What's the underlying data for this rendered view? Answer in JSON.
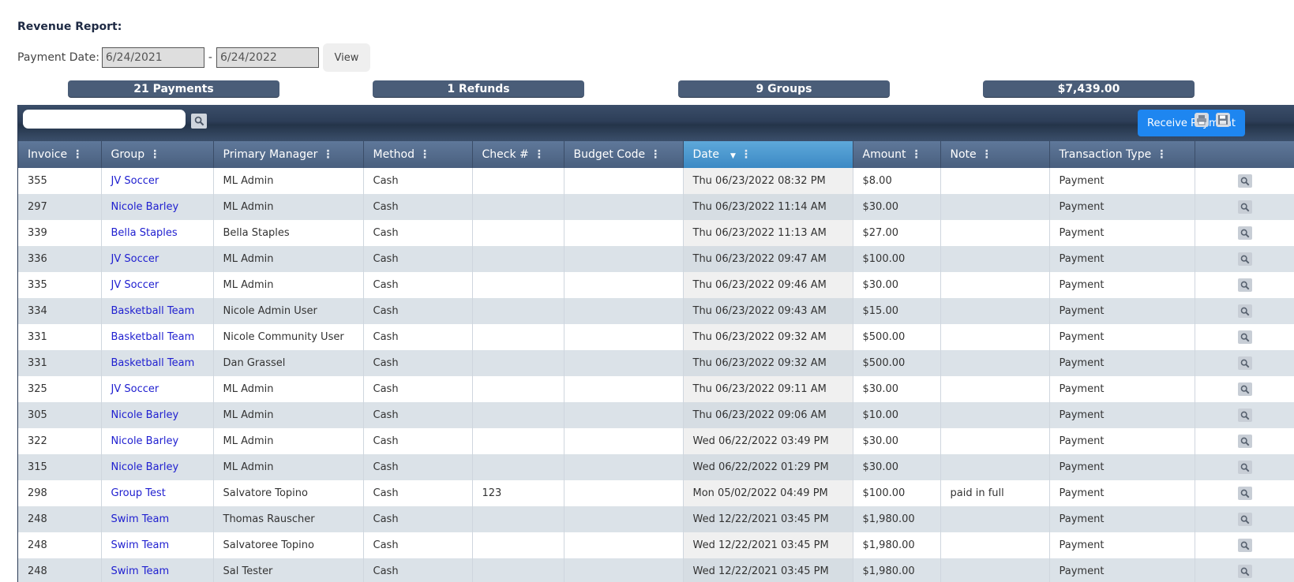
{
  "report": {
    "title": "Revenue Report:",
    "date_label": "Payment Date:",
    "start_date": "6/24/2021",
    "date_separator": "-",
    "end_date": "6/24/2022",
    "view_label": "View"
  },
  "stats": {
    "payments": "21 Payments",
    "refunds": "1 Refunds",
    "groups": "9 Groups",
    "total": "$7,439.00"
  },
  "toolbar": {
    "search_value": "",
    "receive_label": "Receive Payment"
  },
  "table": {
    "columns": [
      "Invoice",
      "Group",
      "Primary Manager",
      "Method",
      "Check #",
      "Budget Code",
      "Date",
      "Amount",
      "Note",
      "Transaction Type"
    ],
    "sorted_column": "Date",
    "rows": [
      [
        "355",
        "JV Soccer",
        "ML Admin",
        "Cash",
        "",
        "",
        "Thu 06/23/2022 08:32 PM",
        "$8.00",
        "",
        "Payment"
      ],
      [
        "297",
        "Nicole Barley",
        "ML Admin",
        "Cash",
        "",
        "",
        "Thu 06/23/2022 11:14 AM",
        "$30.00",
        "",
        "Payment"
      ],
      [
        "339",
        "Bella Staples",
        "Bella Staples",
        "Cash",
        "",
        "",
        "Thu 06/23/2022 11:13 AM",
        "$27.00",
        "",
        "Payment"
      ],
      [
        "336",
        "JV Soccer",
        "ML Admin",
        "Cash",
        "",
        "",
        "Thu 06/23/2022 09:47 AM",
        "$100.00",
        "",
        "Payment"
      ],
      [
        "335",
        "JV Soccer",
        "ML Admin",
        "Cash",
        "",
        "",
        "Thu 06/23/2022 09:46 AM",
        "$30.00",
        "",
        "Payment"
      ],
      [
        "334",
        "Basketball Team",
        "Nicole Admin User",
        "Cash",
        "",
        "",
        "Thu 06/23/2022 09:43 AM",
        "$15.00",
        "",
        "Payment"
      ],
      [
        "331",
        "Basketball Team",
        "Nicole Community User",
        "Cash",
        "",
        "",
        "Thu 06/23/2022 09:32 AM",
        "$500.00",
        "",
        "Payment"
      ],
      [
        "331",
        "Basketball Team",
        "Dan Grassel",
        "Cash",
        "",
        "",
        "Thu 06/23/2022 09:32 AM",
        "$500.00",
        "",
        "Payment"
      ],
      [
        "325",
        "JV Soccer",
        "ML Admin",
        "Cash",
        "",
        "",
        "Thu 06/23/2022 09:11 AM",
        "$30.00",
        "",
        "Payment"
      ],
      [
        "305",
        "Nicole Barley",
        "ML Admin",
        "Cash",
        "",
        "",
        "Thu 06/23/2022 09:06 AM",
        "$10.00",
        "",
        "Payment"
      ],
      [
        "322",
        "Nicole Barley",
        "ML Admin",
        "Cash",
        "",
        "",
        "Wed 06/22/2022 03:49 PM",
        "$30.00",
        "",
        "Payment"
      ],
      [
        "315",
        "Nicole Barley",
        "ML Admin",
        "Cash",
        "",
        "",
        "Wed 06/22/2022 01:29 PM",
        "$30.00",
        "",
        "Payment"
      ],
      [
        "298",
        "Group Test",
        "Salvatore Topino",
        "Cash",
        "123",
        "",
        "Mon 05/02/2022 04:49 PM",
        "$100.00",
        "paid in full",
        "Payment"
      ],
      [
        "248",
        "Swim Team",
        "Thomas Rauscher",
        "Cash",
        "",
        "",
        "Wed 12/22/2021 03:45 PM",
        "$1,980.00",
        "",
        "Payment"
      ],
      [
        "248",
        "Swim Team",
        "Salvatoree Topino",
        "Cash",
        "",
        "",
        "Wed 12/22/2021 03:45 PM",
        "$1,980.00",
        "",
        "Payment"
      ],
      [
        "248",
        "Swim Team",
        "Sal Tester",
        "Cash",
        "",
        "",
        "Wed 12/22/2021 03:45 PM",
        "$1,980.00",
        "",
        "Payment"
      ]
    ]
  },
  "icons": {
    "search": "magnifier-icon",
    "print": "printer-icon",
    "save": "floppy-disk-icon",
    "row_action": "magnifier-icon",
    "column_menu": "vertical-dots-icon",
    "sort": "sort-down-arrow-icon"
  },
  "colors": {
    "stat_badge": "#4a5d78",
    "header": "#4f6584",
    "sorted_header": "#3b89c4",
    "accent_button": "#1e86f0",
    "link": "#2020d0",
    "alt_row": "#dbe2e8"
  }
}
